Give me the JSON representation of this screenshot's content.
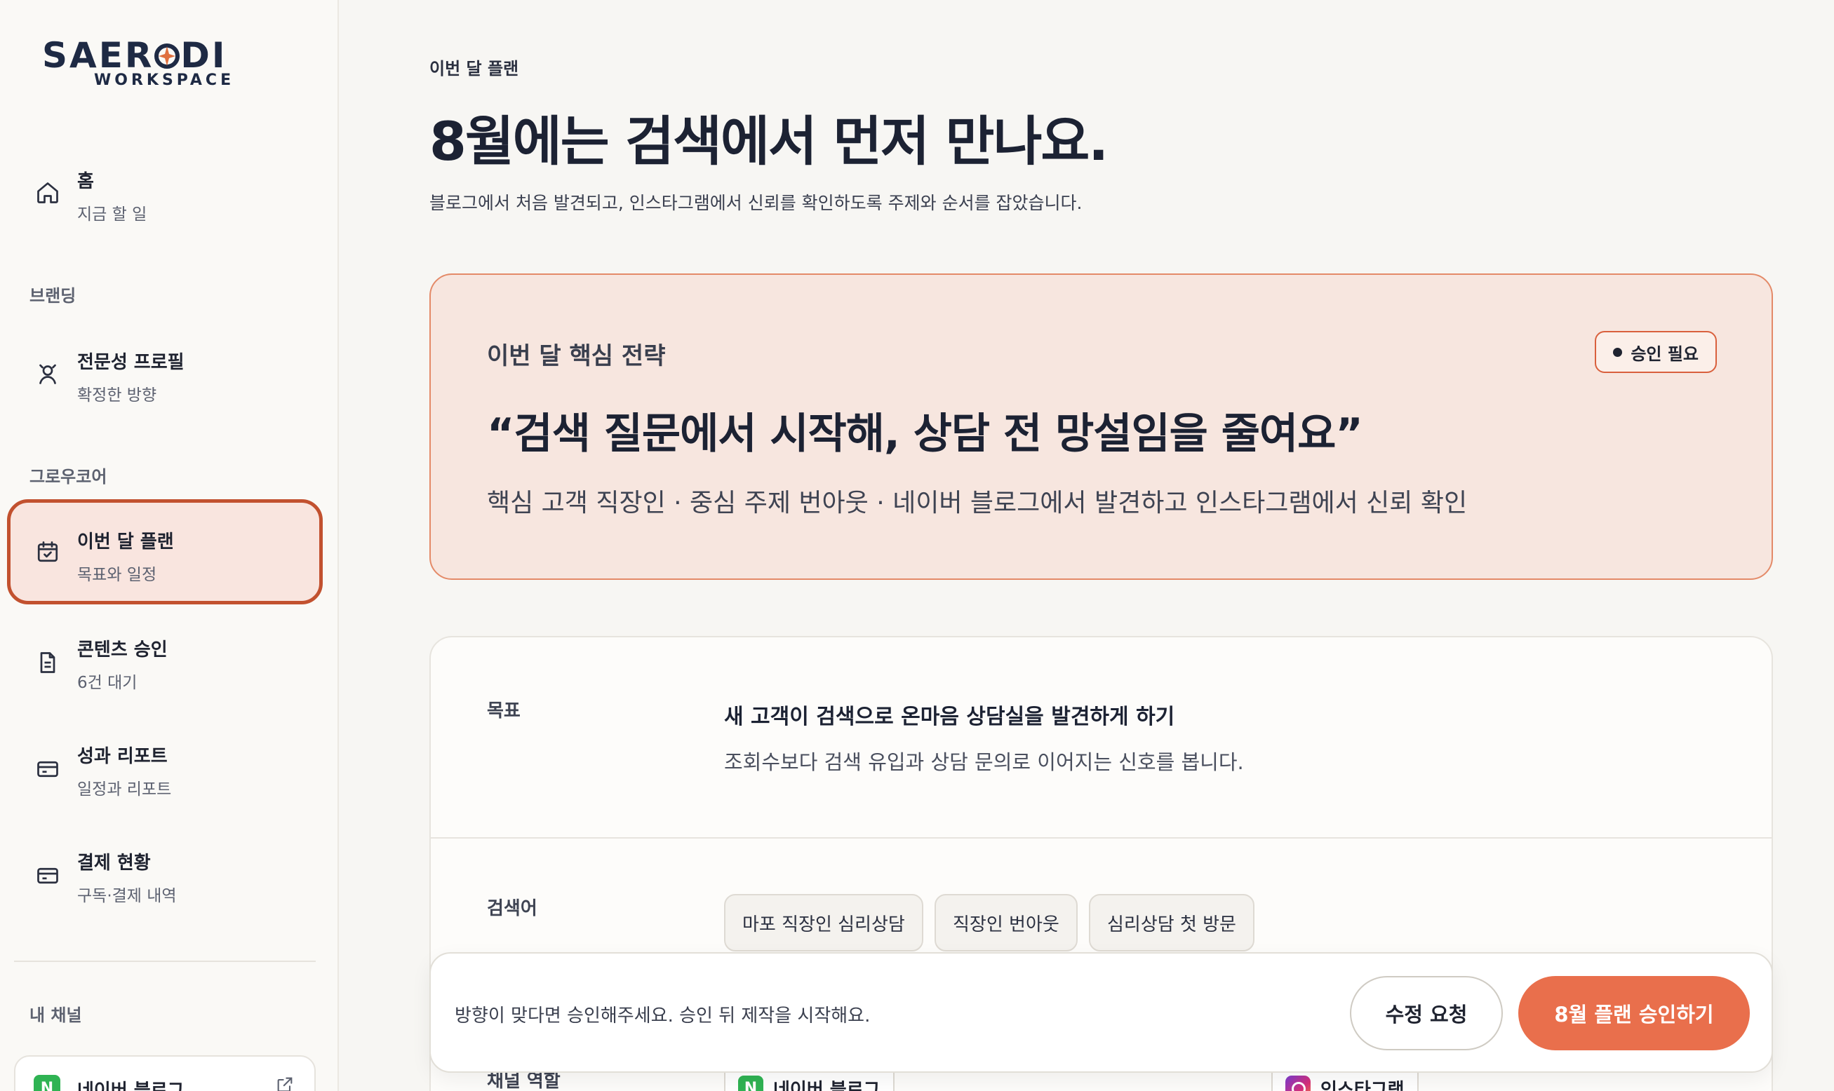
{
  "brand": {
    "logo_main_left": "SAER",
    "logo_main_right": "DI",
    "logo_sub": "WORKSPACE",
    "accent": "#e96f4c"
  },
  "sidebar": {
    "home": {
      "title": "홈",
      "sub": "지금 할 일",
      "icon": "home-icon"
    },
    "section_branding": "브랜딩",
    "profile": {
      "title": "전문성 프로필",
      "sub": "확정한 방향",
      "icon": "person-icon"
    },
    "section_growcore": "그로우코어",
    "plan": {
      "title": "이번 달 플랜",
      "sub": "목표와 일정",
      "icon": "calendar-check-icon"
    },
    "approval": {
      "title": "콘텐츠 승인",
      "sub": "6건 대기",
      "icon": "document-icon"
    },
    "report": {
      "title": "성과 리포트",
      "sub": "일정과 리포트",
      "icon": "card-icon"
    },
    "billing": {
      "title": "결제 현황",
      "sub": "구독·결제 내역",
      "icon": "credit-card-icon"
    },
    "section_channels": "내 채널",
    "channel": {
      "badge": "N",
      "label": "네이버 블로그",
      "icon": "external-link-icon"
    }
  },
  "main": {
    "eyebrow": "이번 달 플랜",
    "title": "8월에는 검색에서 먼저 만나요.",
    "description": "블로그에서 처음 발견되고, 인스타그램에서 신뢰를 확인하도록 주제와 순서를 잡았습니다.",
    "strategy": {
      "label": "이번 달 핵심 전략",
      "badge": "승인 필요",
      "quote": "“검색 질문에서 시작해, 상담 전 망설임을 줄여요”",
      "summary": "핵심 고객 직장인 · 중심 주제 번아웃 · 네이버 블로그에서 발견하고 인스타그램에서 신뢰 확인"
    },
    "detail": {
      "goal_label": "목표",
      "goal_title": "새 고객이 검색으로 온마음 상담실을 발견하게 하기",
      "goal_sub": "조회수보다 검색 유입과 상담 문의로 이어지는 신호를 봅니다.",
      "keywords_label": "검색어",
      "keywords": [
        "마포 직장인 심리상담",
        "직장인 번아웃",
        "심리상담 첫 방문"
      ],
      "channel_label": "채널 역할",
      "channel_naver": "네이버 블로그",
      "channel_naver_badge": "N",
      "channel_instagram": "인스타그램"
    },
    "action_bar": {
      "text": "방향이 맞다면 승인해주세요. 승인 뒤 제작을 시작해요.",
      "secondary": "수정 요청",
      "primary": "8월 플랜 승인하기"
    }
  }
}
